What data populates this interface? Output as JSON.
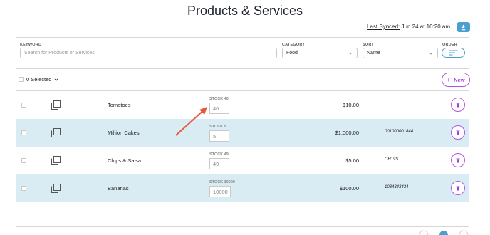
{
  "header": {
    "title": "Products & Services",
    "last_synced_label": "Last Synced:",
    "last_synced_value": "Jun 24 at 10:20 am",
    "download_icon": "download-icon",
    "accent_color": "#4a9fd0"
  },
  "filters": {
    "keyword_label": "KEYWORD",
    "keyword_placeholder": "Search for Products or Services",
    "category_label": "CATEGORY",
    "category_value": "Food",
    "sort_label": "SORT",
    "sort_value": "Name",
    "order_label": "ORDER",
    "order_icon": "sort-lines-icon"
  },
  "toolbar": {
    "selected_label": "0 Selected",
    "new_label": "New",
    "new_icon": "plus-icon",
    "brand_purple": "#a040d8"
  },
  "rows": [
    {
      "name": "Tomatoes",
      "stock_label": "STOCK 40",
      "stock_value": "40",
      "price": "$10.00",
      "code": ""
    },
    {
      "name": "Million Cakes",
      "stock_label": "STOCK 5",
      "stock_value": "5",
      "price": "$1,000.00",
      "code": "001000001844"
    },
    {
      "name": "Chips & Salsa",
      "stock_label": "STOCK 49",
      "stock_value": "49",
      "price": "$5.00",
      "code": "CH19S"
    },
    {
      "name": "Bananas",
      "stock_label": "STOCK 10000",
      "stock_value": "10000",
      "price": "$100.00",
      "code": "1034343434"
    }
  ],
  "annotation": {
    "arrow_color": "#e8553a",
    "arrow_icon": "pointer-arrow"
  }
}
